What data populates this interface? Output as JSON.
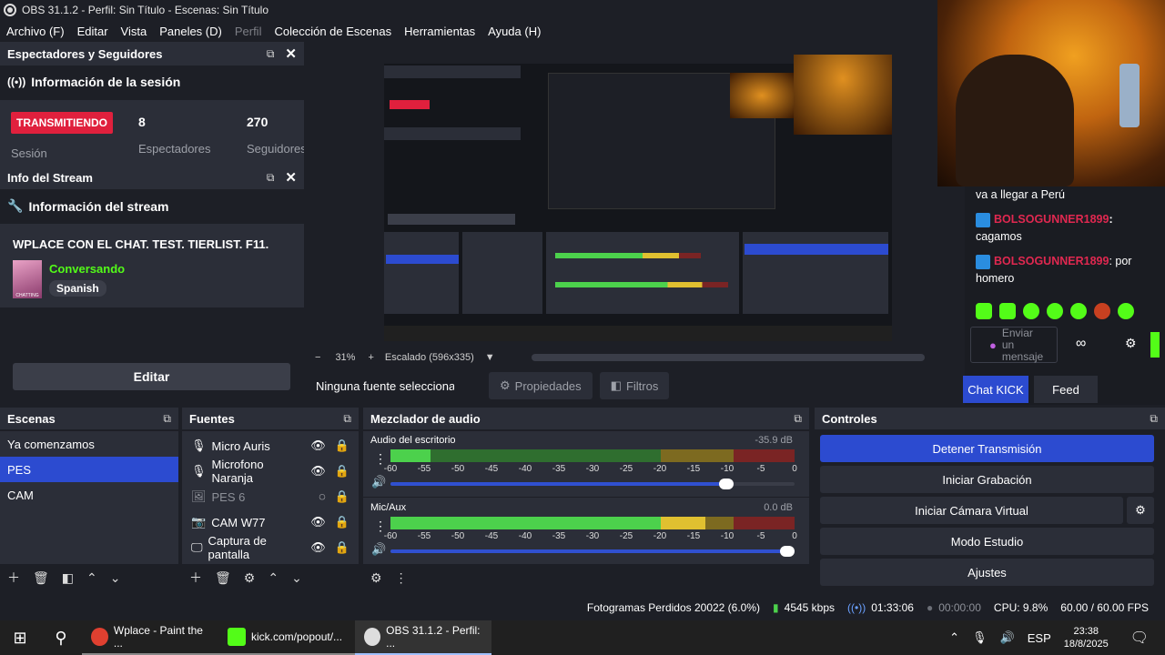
{
  "window": {
    "title": "OBS 31.1.2 - Perfil: Sin Título - Escenas: Sin Título"
  },
  "menu": [
    {
      "label": "Archivo (F)",
      "disabled": false
    },
    {
      "label": "Editar",
      "disabled": false
    },
    {
      "label": "Vista",
      "disabled": false
    },
    {
      "label": "Paneles (D)",
      "disabled": false
    },
    {
      "label": "Perfil",
      "disabled": true
    },
    {
      "label": "Colección de Escenas",
      "disabled": false
    },
    {
      "label": "Herramientas",
      "disabled": false
    },
    {
      "label": "Ayuda (H)",
      "disabled": false
    }
  ],
  "viewers_dock": {
    "title": "Espectadores y Seguidores",
    "section": "Información de la sesión",
    "status": "TRANSMITIENDO",
    "status_caption": "Sesión",
    "viewers_value": "8",
    "viewers_caption": "Espectadores",
    "followers_value": "270",
    "followers_caption": "Seguidores"
  },
  "stream_dock": {
    "title": "Info del Stream",
    "section": "Información del stream",
    "stream_title": "WPLACE CON EL CHAT. TEST. TIERLIST. F11.",
    "category": "Conversando",
    "language": "Spanish",
    "edit_label": "Editar",
    "thumb_label": "CHATTING"
  },
  "preview": {
    "zoom": "31%",
    "scale_label": "Escalado (596x335)"
  },
  "source_toolbar": {
    "no_source": "Ninguna fuente seleccionad",
    "properties": "Propiedades",
    "filters": "Filtros"
  },
  "chat": {
    "lines": [
      {
        "user": "",
        "text": "va a llegar a Perú"
      },
      {
        "user": "BOLSOGUNNER1899",
        "text": ":"
      },
      {
        "user": "",
        "text": "cagamos"
      },
      {
        "user": "BOLSOGUNNER1899",
        "text": ": por"
      },
      {
        "user": "",
        "text": "homero"
      }
    ],
    "input_placeholder": "Enviar un mensaje",
    "emote_count": "∞",
    "tabs": [
      {
        "label": "Chat KICK",
        "active": true
      },
      {
        "label": "Feed",
        "active": false
      }
    ]
  },
  "scenes": {
    "title": "Escenas",
    "items": [
      {
        "label": "Ya comenzamos",
        "active": false
      },
      {
        "label": "PES",
        "active": true
      },
      {
        "label": "CAM",
        "active": false
      }
    ]
  },
  "sources": {
    "title": "Fuentes",
    "items": [
      {
        "label": "Micro Auris",
        "icon": "microphone-icon",
        "visible": true
      },
      {
        "label": "Microfono Naranja",
        "icon": "microphone-icon",
        "visible": true
      },
      {
        "label": "PES 6",
        "icon": "image-icon",
        "visible": false
      },
      {
        "label": "CAM W77",
        "icon": "camera-icon",
        "visible": true
      },
      {
        "label": "Captura de pantalla",
        "icon": "monitor-icon",
        "visible": true
      }
    ]
  },
  "mixer": {
    "title": "Mezclador de audio",
    "channels": [
      {
        "name": "Audio del escritorio",
        "db": "-35.9 dB",
        "level": 0.1,
        "volume": 0.85
      },
      {
        "name": "Mic/Aux",
        "db": "0.0 dB",
        "level": 0.78,
        "volume": 1.0
      }
    ],
    "ticks": [
      "-60",
      "-55",
      "-50",
      "-45",
      "-40",
      "-35",
      "-30",
      "-25",
      "-20",
      "-15",
      "-10",
      "-5",
      "0"
    ]
  },
  "controls": {
    "title": "Controles",
    "buttons": [
      {
        "label": "Detener Transmisión",
        "primary": true
      },
      {
        "label": "Iniciar Grabación",
        "primary": false
      },
      {
        "label": "Iniciar Cámara Virtual",
        "primary": false
      },
      {
        "label": "Modo Estudio",
        "primary": false
      },
      {
        "label": "Ajustes",
        "primary": false
      }
    ]
  },
  "status": {
    "dropped_frames": "Fotogramas Perdidos 20022 (6.0%)",
    "bitrate": "4545 kbps",
    "stream_time": "01:33:06",
    "rec_time": "00:00:00",
    "cpu": "CPU: 9.8%",
    "fps": "60.00 / 60.00 FPS"
  },
  "taskbar": {
    "apps": [
      {
        "label": "Wplace - Paint the ...",
        "color": "#e04030"
      },
      {
        "label": "kick.com/popout/...",
        "color": "#53fc18"
      },
      {
        "label": "OBS 31.1.2 - Perfil: ...",
        "color": "#dddddd"
      }
    ],
    "lang": "ESP",
    "time": "23:38",
    "date": "18/8/2025"
  },
  "colors": {
    "accent": "#2c4bd0",
    "live": "#e0203d",
    "kick_green": "#53fc18",
    "chat_user": "#e02850"
  }
}
